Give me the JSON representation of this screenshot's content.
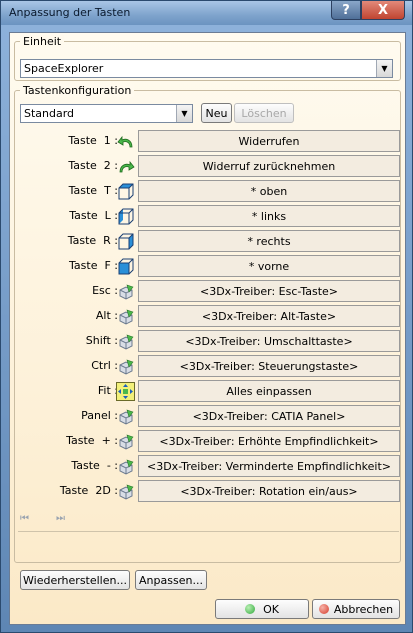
{
  "window": {
    "title": "Anpassung der Tasten",
    "help_label": "?",
    "close_label": "X"
  },
  "unit_group": {
    "label": "Einheit",
    "selected": "SpaceExplorer"
  },
  "config_group": {
    "label": "Tastenkonfiguration",
    "selected": "Standard",
    "new_label": "Neu",
    "delete_label": "Löschen"
  },
  "rows": [
    {
      "key": "Taste  1 :",
      "icon": "undo-icon",
      "action": "Widerrufen"
    },
    {
      "key": "Taste  2 :",
      "icon": "redo-icon",
      "action": "Widerruf zurücknehmen"
    },
    {
      "key": "Taste  T :",
      "icon": "view-top-icon",
      "action": "* oben"
    },
    {
      "key": "Taste  L :",
      "icon": "view-left-icon",
      "action": "* links"
    },
    {
      "key": "Taste  R :",
      "icon": "view-right-icon",
      "action": "* rechts"
    },
    {
      "key": "Taste  F :",
      "icon": "view-front-icon",
      "action": "* vorne"
    },
    {
      "key": "Esc :",
      "icon": "driver-icon",
      "action": "<3Dx-Treiber: Esc-Taste>"
    },
    {
      "key": "Alt :",
      "icon": "driver-icon",
      "action": "<3Dx-Treiber: Alt-Taste>"
    },
    {
      "key": "Shift :",
      "icon": "driver-icon",
      "action": "<3Dx-Treiber: Umschalttaste>"
    },
    {
      "key": "Ctrl :",
      "icon": "driver-icon",
      "action": "<3Dx-Treiber: Steuerungstaste>"
    },
    {
      "key": "Fit :",
      "icon": "fit-all-icon",
      "action": "Alles einpassen"
    },
    {
      "key": "Panel :",
      "icon": "driver-icon",
      "action": "<3Dx-Treiber: CATIA Panel>"
    },
    {
      "key": "Taste  + :",
      "icon": "driver-icon",
      "action": "<3Dx-Treiber: Erhöhte Empfindlichkeit>"
    },
    {
      "key": "Taste  - :",
      "icon": "driver-icon",
      "action": "<3Dx-Treiber: Verminderte Empfindlichkeit>"
    },
    {
      "key": "Taste  2D :",
      "icon": "driver-icon",
      "action": "<3Dx-Treiber: Rotation ein/aus>"
    }
  ],
  "nav": {
    "prev": "⏮",
    "next": "⏭"
  },
  "footer": {
    "restore_label": "Wiederherstellen...",
    "customize_label": "Anpassen...",
    "ok_label": "OK",
    "cancel_label": "Abbrechen"
  },
  "colors": {
    "ok_dot": "#2fa83a",
    "cancel_dot": "#d43a2a",
    "icon_blue": "#2a8fd8",
    "icon_green": "#4bb84b"
  }
}
